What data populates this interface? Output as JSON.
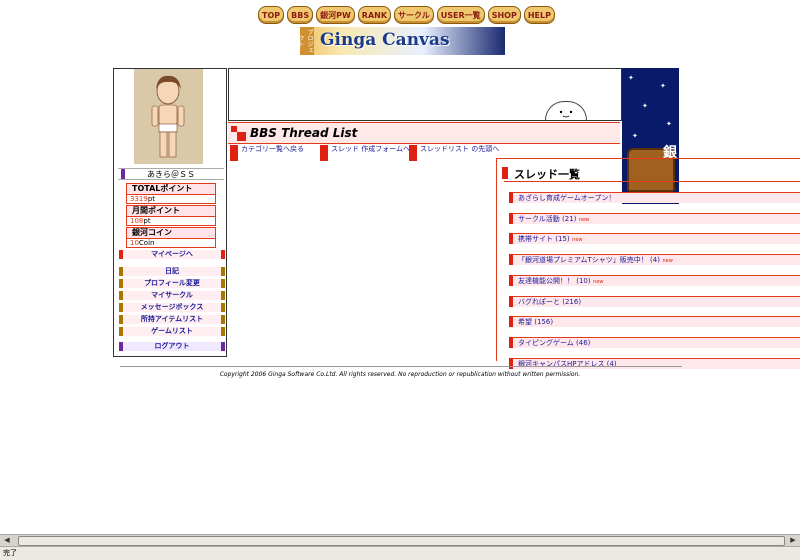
{
  "nav": [
    "TOP",
    "BBS",
    "銀河PW",
    "RANK",
    "サークル",
    "USER一覧",
    "SHOP",
    "HELP"
  ],
  "logo": {
    "title": "Ginga Canvas",
    "tag": "プロジェクト"
  },
  "sidebar": {
    "username": "あきら＠ＳＳ",
    "stats": [
      {
        "label": "TOTALポイント",
        "value": "3319",
        "unit": "pt"
      },
      {
        "label": "月間ポイント",
        "value": "108",
        "unit": "pt"
      },
      {
        "label": "銀河コイン",
        "value": "10",
        "unit": "Coin"
      }
    ],
    "mypage": "マイページへ",
    "menu": [
      "日記",
      "プロフィール変更",
      "マイサークル",
      "メッセージボックス",
      "所持アイテムリスト",
      "ゲームリスト"
    ],
    "logout": "ログアウト"
  },
  "banner": {
    "kanji": "銀"
  },
  "bbs": {
    "title": "BBS Thread List",
    "links": [
      "カテゴリ一覧へ戻る",
      "スレッド 作成フォームへ",
      "スレッドリスト の先頭へ"
    ],
    "list_title": "スレッド一覧",
    "threads": [
      {
        "title": "あざらし育成ゲームオープン！",
        "count": "",
        "new": ""
      },
      {
        "title": "サークル活動 (21)",
        "count": "",
        "new": "new"
      },
      {
        "title": "携帯サイト (15)",
        "count": "",
        "new": "new"
      },
      {
        "title": "「銀河道場プレミアムTシャツ」販売中！ (4)",
        "count": "",
        "new": "new"
      },
      {
        "title": "友達機能公開！！ (10)",
        "count": "",
        "new": "new"
      },
      {
        "title": "バグれぽーと (216)",
        "count": "",
        "new": ""
      },
      {
        "title": "希望 (156)",
        "count": "",
        "new": ""
      },
      {
        "title": "タイピングゲーム (46)",
        "count": "",
        "new": ""
      },
      {
        "title": "銀河キャンパスHPアドレス (4)",
        "count": "",
        "new": ""
      }
    ]
  },
  "copyright": "Copyright 2006 Ginga Software Co.Ltd. All rights reserved. No reproduction or republication without written permission.",
  "status": "完了"
}
